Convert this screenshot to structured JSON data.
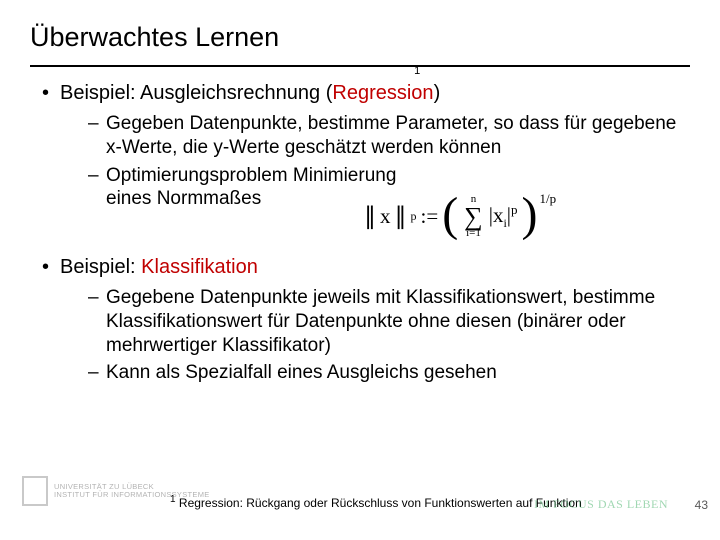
{
  "title": "Überwachtes Lernen",
  "bullet1": {
    "prefix": "Beispiel: Ausgleichsrechnung (",
    "keyword": "Regression",
    "suffix": ")",
    "fn_mark": "1",
    "sub": [
      "Gegeben Datenpunkte, bestimme Parameter, so dass für gegebene x-Werte, die y-Werte geschätzt werden können",
      "Optimierungsproblem Minimierung eines Normmaßes"
    ]
  },
  "bullet2": {
    "prefix": "Beispiel: ",
    "keyword": "Klassifikation",
    "sub": [
      "Gegebene Datenpunkte jeweils mit Klassifikationswert, bestimme Klassifikationswert für Datenpunkte ohne diesen (binärer oder mehrwertiger Klassifikator)",
      "Kann als Spezialfall eines Ausgleichs gesehen"
    ]
  },
  "formula": {
    "lhs_open": "∥",
    "lhs_var": "x",
    "lhs_close": "∥",
    "lhs_sub": "p",
    "assign": " := ",
    "sum_top": "n",
    "sum_sym": "∑",
    "sum_bot": "i=1",
    "term_open": "|",
    "term_var": "x",
    "term_sub": "i",
    "term_close": "|",
    "term_pow": "p",
    "outer_pow": "1/p"
  },
  "footnote": {
    "mark": "1",
    "text": " Regression: Rückgang oder Rückschluss von Funktionswerten auf Funktion"
  },
  "logo": {
    "l1": "UNIVERSITÄT ZU LÜBECK",
    "l2": "INSTITUT FÜR INFORMATIONSSYSTEME"
  },
  "tagline": "IM FOCUS DAS LEBEN",
  "page": "43"
}
